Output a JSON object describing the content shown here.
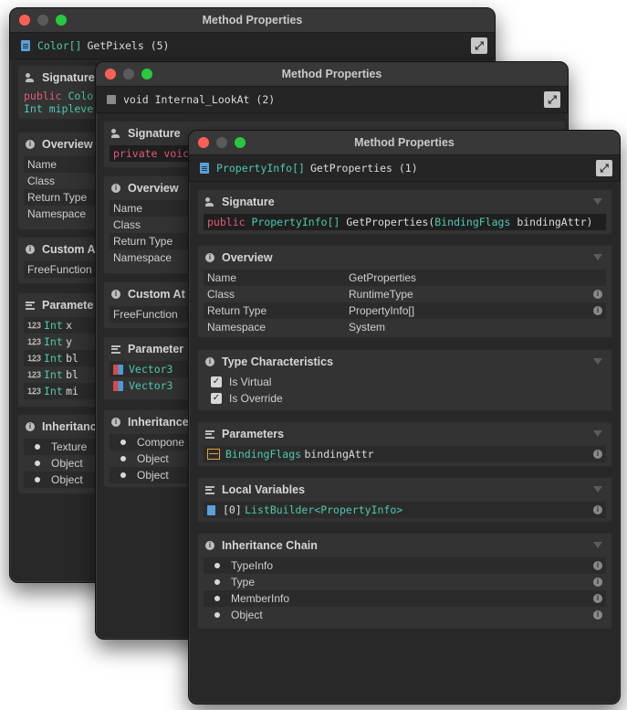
{
  "windows": {
    "w1": {
      "title": "Method Properties",
      "method_type": "Color[]",
      "method_name": "GetPixels (5)",
      "signature_kw": "public",
      "signature_ty": "Color",
      "signature_line2": "Int mipleve",
      "sections": {
        "signature": "Signature",
        "overview": "Overview",
        "custom": "Custom A",
        "parameters": "Paramete",
        "inheritance": "Inheritance"
      },
      "overview_keys": [
        "Name",
        "Class",
        "Return Type",
        "Namespace"
      ],
      "custom_value": "FreeFunction",
      "params": [
        {
          "type": "Int",
          "name": "x"
        },
        {
          "type": "Int",
          "name": "y"
        },
        {
          "type": "Int",
          "name": "bl"
        },
        {
          "type": "Int",
          "name": "bl"
        },
        {
          "type": "Int",
          "name": "mi"
        }
      ],
      "inheritance": [
        "Texture",
        "Object",
        "Object"
      ]
    },
    "w2": {
      "title": "Method Properties",
      "method_name": "void Internal_LookAt (2)",
      "signature_kw": "private",
      "signature_rest": "voic",
      "sections": {
        "signature": "Signature",
        "overview": "Overview",
        "custom": "Custom At",
        "parameters": "Parameter",
        "inheritance": "Inheritance"
      },
      "overview_keys": [
        "Name",
        "Class",
        "Return Type",
        "Namespace"
      ],
      "custom_value": "FreeFunction",
      "params": [
        "Vector3",
        "Vector3"
      ],
      "inheritance": [
        "Compone",
        "Object",
        "Object"
      ]
    },
    "w3": {
      "title": "Method Properties",
      "method_type": "PropertyInfo[]",
      "method_name": "GetProperties (1)",
      "sections": {
        "signature": "Signature",
        "overview": "Overview",
        "type_chars": "Type Characteristics",
        "parameters": "Parameters",
        "local_vars": "Local Variables",
        "inheritance": "Inheritance Chain"
      },
      "signature": {
        "kw": "public",
        "ret": "PropertyInfo[]",
        "name": "GetProperties(",
        "param_type": "BindingFlags",
        "param_name": "bindingAttr)"
      },
      "overview": [
        {
          "key": "Name",
          "value": "GetProperties",
          "info": false
        },
        {
          "key": "Class",
          "value": "RuntimeType",
          "info": true
        },
        {
          "key": "Return Type",
          "value": "PropertyInfo[]",
          "info": true
        },
        {
          "key": "Namespace",
          "value": "System",
          "info": false
        }
      ],
      "type_chars": [
        "Is Virtual",
        "Is Override"
      ],
      "param": {
        "type": "BindingFlags",
        "name": "bindingAttr"
      },
      "local_var": {
        "index": "[0]",
        "type": "ListBuilder<PropertyInfo>"
      },
      "inheritance": [
        "TypeInfo",
        "Type",
        "MemberInfo",
        "Object"
      ]
    }
  },
  "icons": {
    "close": "close-icon",
    "minimize": "minimize-icon",
    "zoom": "zoom-icon",
    "expand": "expand-icon",
    "info": "info-icon",
    "chevron": "chevron-down-icon"
  },
  "colors": {
    "keyword": "#e35a77",
    "type": "#4ec9b0",
    "window_bg": "#282828"
  }
}
